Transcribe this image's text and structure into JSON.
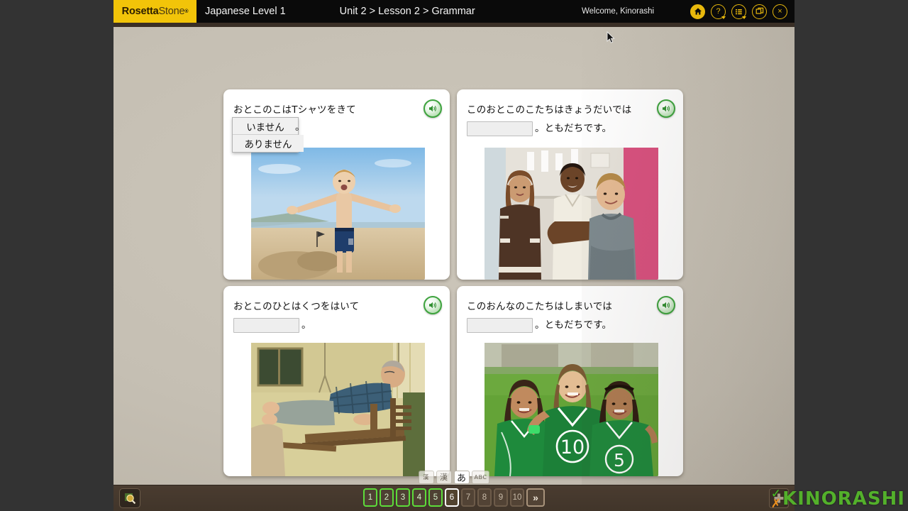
{
  "titlebar": {
    "brand_part1": "Rosetta",
    "brand_part2": "Stone",
    "brand_reg": "®",
    "course": "Japanese Level 1",
    "breadcrumb": "Unit 2 > Lesson 2 > Grammar",
    "welcome": "Welcome, Kinorashi",
    "icons": [
      {
        "name": "home-icon",
        "label": ""
      },
      {
        "name": "help-icon",
        "label": "?"
      },
      {
        "name": "menu-icon",
        "label": ""
      },
      {
        "name": "window-icon",
        "label": ""
      },
      {
        "name": "close-icon",
        "label": "×"
      }
    ]
  },
  "exercise": {
    "cards": [
      {
        "id": "card-1",
        "line1": "おとこのこはTシャツをきて",
        "line2_after_blank": "。",
        "blank_state": "dropdown-open",
        "dropdown_options": [
          "いません",
          "ありません"
        ],
        "speaker_label": "audio",
        "photo_alt": "boy-on-beach"
      },
      {
        "id": "card-2",
        "line1": "このおとこのこたちはきょうだいでは",
        "line2_after_blank": "。ともだちです。",
        "blank_state": "empty",
        "dropdown_options": [],
        "speaker_label": "audio",
        "photo_alt": "three-kids-hallway"
      },
      {
        "id": "card-3",
        "line1": "おとこのひとはくつをはいて",
        "line2_after_blank": "。",
        "blank_state": "empty",
        "dropdown_options": [],
        "speaker_label": "audio",
        "photo_alt": "man-on-porch-swing"
      },
      {
        "id": "card-4",
        "line1": "このおんなのこたちはしまいでは",
        "line2_after_blank": "。ともだちです。",
        "blank_state": "empty",
        "dropdown_options": [],
        "speaker_label": "audio",
        "photo_alt": "three-girls-soccer"
      }
    ]
  },
  "script_toggle": {
    "buttons": [
      {
        "label": "漢",
        "name": "kanji-furigana-toggle",
        "active": false,
        "small": true
      },
      {
        "label": "漢",
        "name": "kanji-toggle",
        "active": false,
        "small": false
      },
      {
        "label": "あ",
        "name": "kana-toggle",
        "active": true,
        "small": false
      },
      {
        "label": "ABC",
        "name": "romaji-toggle",
        "active": false,
        "small": true
      }
    ]
  },
  "bottombar": {
    "zoom_label": "",
    "pages": [
      {
        "label": "1",
        "state": "done"
      },
      {
        "label": "2",
        "state": "done"
      },
      {
        "label": "3",
        "state": "done"
      },
      {
        "label": "4",
        "state": "done"
      },
      {
        "label": "5",
        "state": "done"
      },
      {
        "label": "6",
        "state": "current"
      },
      {
        "label": "7",
        "state": "inactive"
      },
      {
        "label": "8",
        "state": "inactive"
      },
      {
        "label": "9",
        "state": "inactive"
      },
      {
        "label": "10",
        "state": "inactive"
      }
    ],
    "next_label": "»",
    "plus_label": ""
  },
  "watermark": {
    "check": "✓",
    "cross": "✗",
    "text": "KINORASHI"
  },
  "colors": {
    "brand_yellow": "#f2c409",
    "titlebar_black": "#0a0a0a",
    "canvas_beige": "#c6c0b4",
    "letterbox": "#333333",
    "bottom_brown": "#463a2e",
    "page_done_green": "#5ddc3a",
    "speaker_green": "#3da33d",
    "watermark_green": "#53b02b"
  }
}
